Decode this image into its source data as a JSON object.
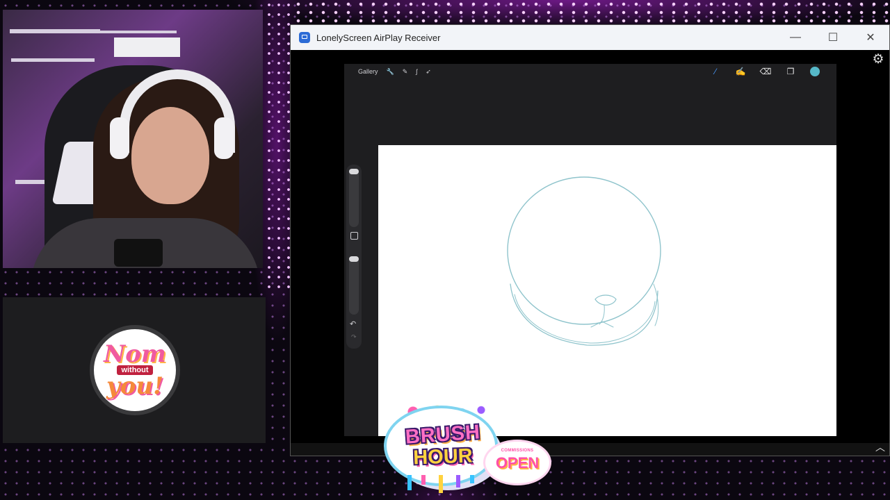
{
  "window": {
    "title": "LonelyScreen AirPlay Receiver",
    "minimize_icon": "minimize-icon",
    "maximize_icon": "maximize-icon",
    "close_icon": "close-icon",
    "minimize_glyph": "—",
    "maximize_glyph": "☐",
    "close_glyph": "✕",
    "settings_glyph": "⚙"
  },
  "procreate": {
    "toolbar": {
      "gallery_label": "Gallery",
      "actions_glyph": "🔧",
      "adjustments_glyph": "✎",
      "selection_glyph": "ʃ",
      "transform_glyph": "➶",
      "brush_glyph": "⁄",
      "smudge_glyph": "✍",
      "eraser_glyph": "⌫",
      "layers_glyph": "❐"
    },
    "current_color": "#56b8c8",
    "undo_glyph": "↶",
    "redo_glyph": "↷"
  },
  "overlay": {
    "logo_line1": "Nom",
    "logo_mid": "without",
    "logo_line3": "you!",
    "badge_brush": "BRUSH",
    "badge_hour": "HOUR",
    "badge_commissions": "COMMISSIONS",
    "badge_open": "OPEN"
  },
  "colors": {
    "accent_purple": "#b62fe0",
    "sketch_stroke": "#8fc4cc"
  }
}
